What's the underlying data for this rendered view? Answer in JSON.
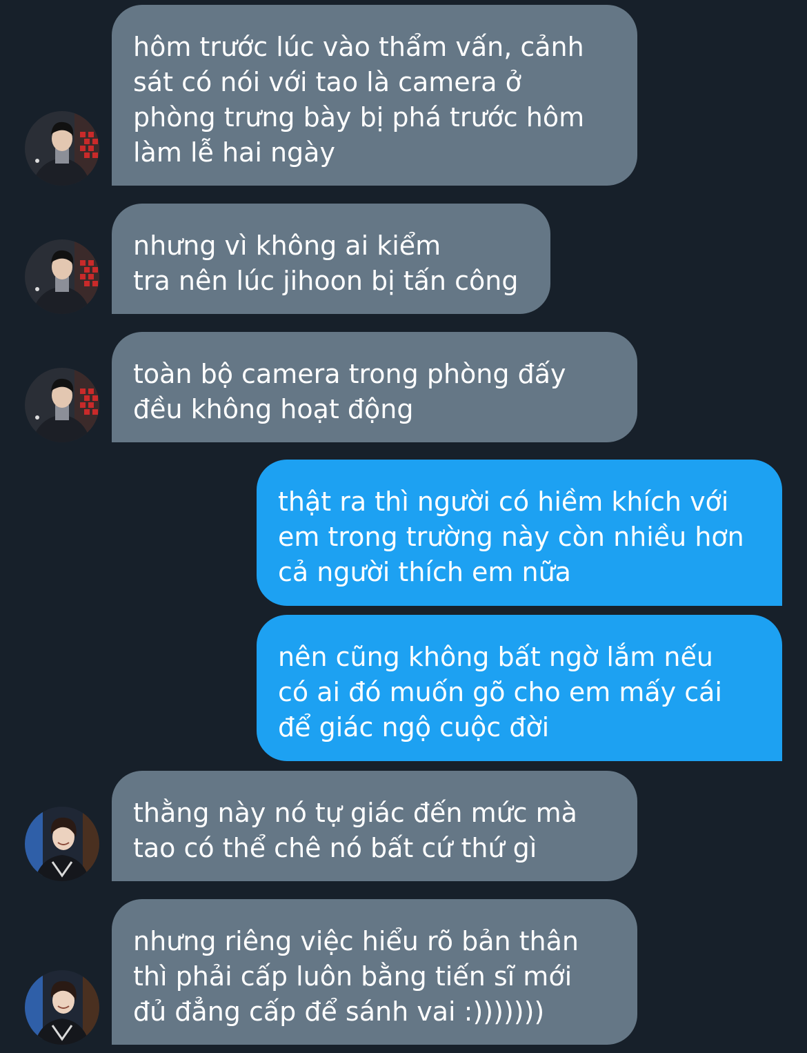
{
  "messages": [
    {
      "direction": "received",
      "avatar": "avatar-boy-turtleneck",
      "lines": [
        "hôm trước lúc vào thẩm vấn, cảnh",
        "sát có nói với tao là camera ở",
        "phòng trưng bày bị phá trước hôm",
        "làm lễ hai ngày"
      ]
    },
    {
      "direction": "received",
      "avatar": "avatar-boy-turtleneck",
      "lines": [
        "nhưng vì không ai kiểm",
        "tra nên lúc jihoon bị tấn công"
      ]
    },
    {
      "direction": "received",
      "avatar": "avatar-boy-turtleneck",
      "lines": [
        "toàn bộ camera trong phòng đấy",
        "đều không hoạt động"
      ]
    },
    {
      "direction": "sent",
      "lines": [
        "thật ra thì người có hiềm khích với",
        "em trong trường này còn nhiều hơn",
        "cả người thích em nữa"
      ]
    },
    {
      "direction": "sent",
      "lines": [
        "nên cũng không bất ngờ lắm nếu",
        "có ai đó muốn gõ cho em mấy cái",
        "để giác ngộ cuộc đời"
      ]
    },
    {
      "direction": "received",
      "avatar": "avatar-smiling-boy",
      "lines": [
        "thằng này nó tự giác đến mức mà",
        "tao có thể chê nó bất cứ thứ gì"
      ]
    },
    {
      "direction": "received",
      "avatar": "avatar-smiling-boy",
      "lines": [
        "nhưng riêng việc hiểu rõ bản thân",
        "thì phải cấp luôn bằng tiến sĩ mới",
        "đủ đẳng cấp để sánh vai :)))))))"
      ]
    }
  ],
  "colors": {
    "background": "#17202a",
    "received_bubble": "#657786",
    "sent_bubble": "#1da1f2",
    "text": "#ffffff"
  }
}
